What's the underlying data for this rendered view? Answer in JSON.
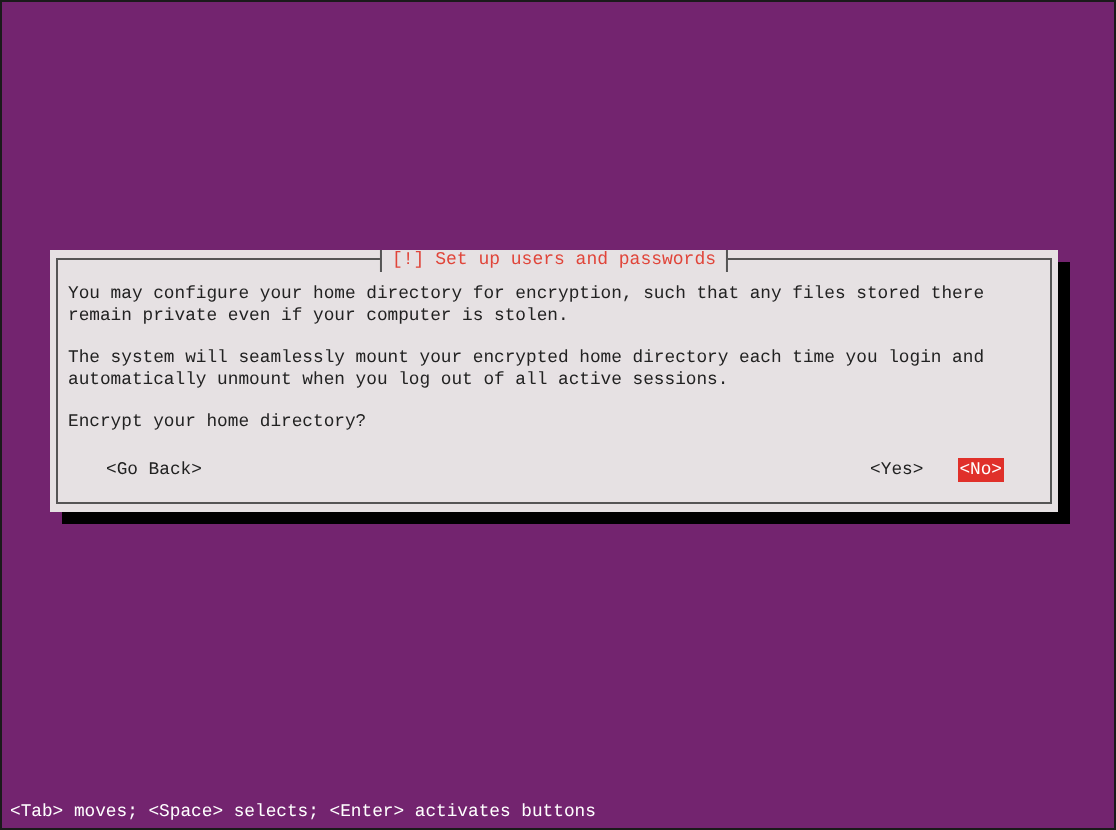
{
  "dialog": {
    "title": "[!] Set up users and passwords",
    "paragraphs": [
      "You may configure your home directory for encryption, such that any files stored there\nremain private even if your computer is stolen.",
      "The system will seamlessly mount your encrypted home directory each time you login and\nautomatically unmount when you log out of all active sessions.",
      "Encrypt your home directory?"
    ],
    "buttons": [
      {
        "label": "<Go Back>",
        "selected": false
      },
      {
        "label": "<Yes>",
        "selected": false
      },
      {
        "label": "<No>",
        "selected": true
      }
    ]
  },
  "help_line": "<Tab> moves; <Space> selects; <Enter> activates buttons"
}
